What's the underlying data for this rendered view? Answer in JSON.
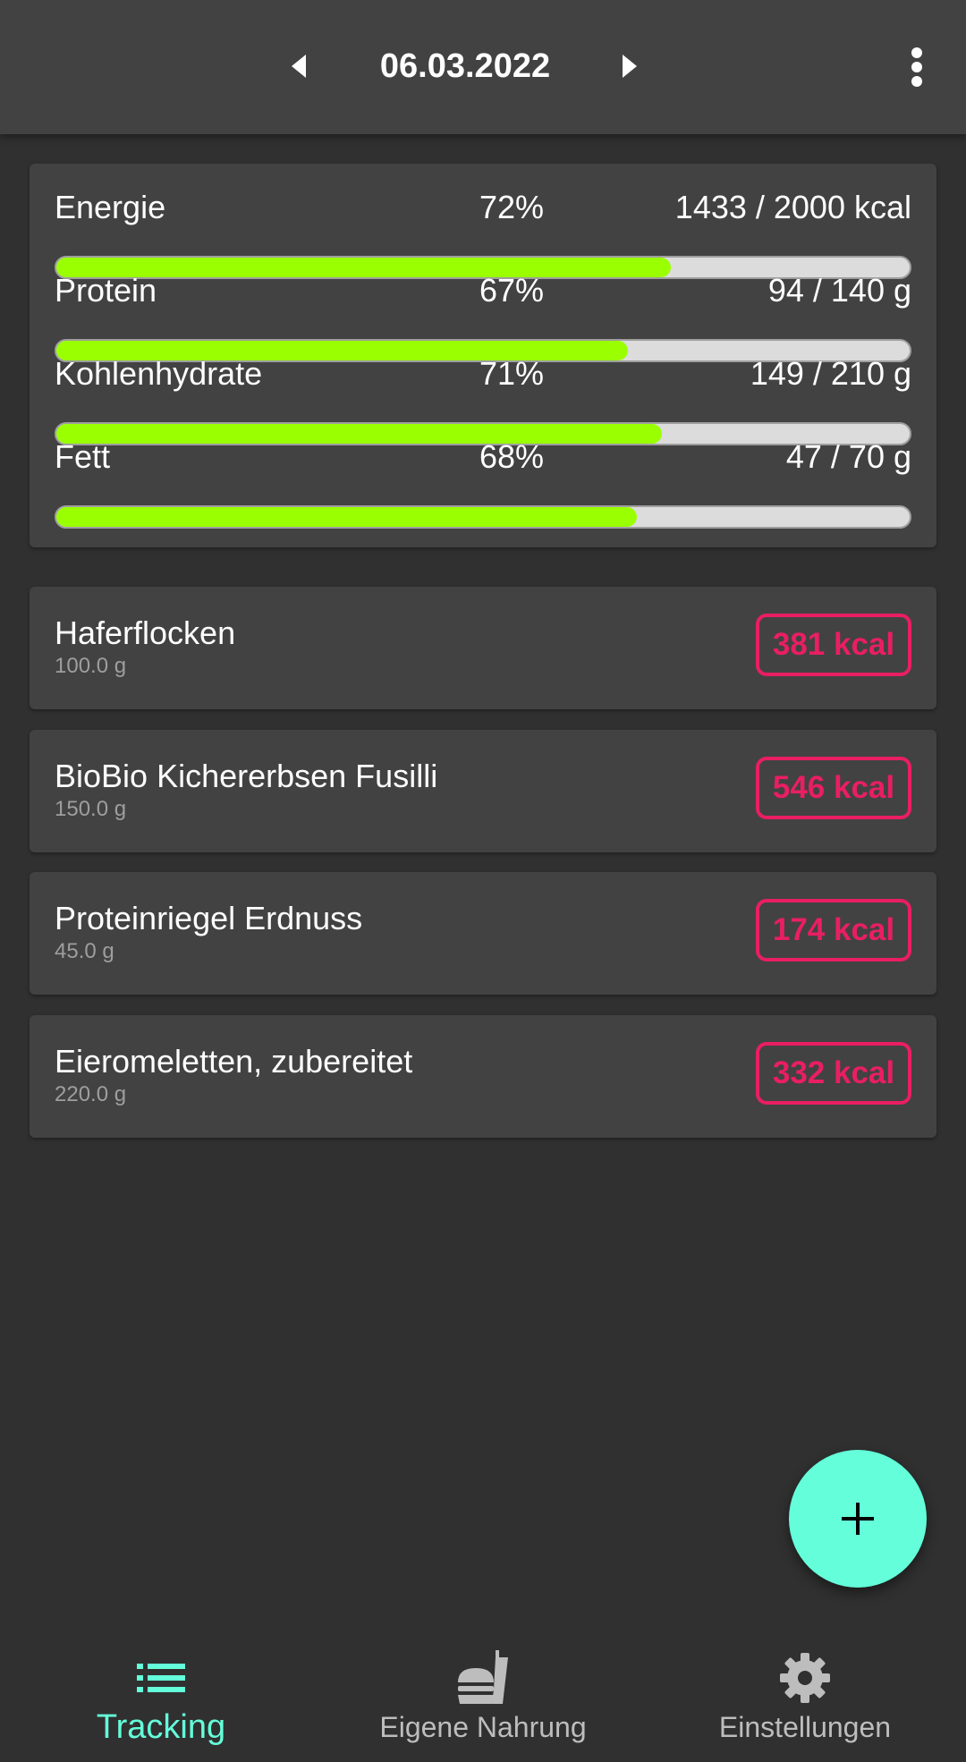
{
  "header": {
    "date": "06.03.2022",
    "prev_icon": "arrow-left-icon",
    "next_icon": "arrow-right-icon",
    "menu_icon": "more-vert-icon"
  },
  "summary": {
    "nutrients": [
      {
        "label": "Energie",
        "percent": "72%",
        "amount": "1433 / 2000 kcal",
        "fraction": 0.72
      },
      {
        "label": "Protein",
        "percent": "67%",
        "amount": "94 / 140 g",
        "fraction": 0.67
      },
      {
        "label": "Kohlenhydrate",
        "percent": "71%",
        "amount": "149 / 210 g",
        "fraction": 0.71
      },
      {
        "label": "Fett",
        "percent": "68%",
        "amount": "47 / 70 g",
        "fraction": 0.68
      }
    ],
    "bar_color": "#9aff00"
  },
  "entries": [
    {
      "name": "Haferflocken",
      "weight": "100.0 g",
      "kcal": "381 kcal"
    },
    {
      "name": "BioBio Kichererbsen Fusilli",
      "weight": "150.0 g",
      "kcal": "546 kcal"
    },
    {
      "name": "Proteinriegel Erdnuss",
      "weight": "45.0 g",
      "kcal": "174 kcal"
    },
    {
      "name": "Eieromeletten, zubereitet",
      "weight": "220.0 g",
      "kcal": "332 kcal"
    }
  ],
  "fab": {
    "icon": "plus-icon",
    "color": "#64ffda"
  },
  "bottom_nav": [
    {
      "label": "Tracking",
      "icon": "list-icon",
      "active": true
    },
    {
      "label": "Eigene Nahrung",
      "icon": "fastfood-icon",
      "active": false
    },
    {
      "label": "Einstellungen",
      "icon": "gear-icon",
      "active": false
    }
  ],
  "colors": {
    "accent": "#64ffda",
    "kcal": "#e91e63",
    "background": "#303030",
    "card": "#424242"
  }
}
